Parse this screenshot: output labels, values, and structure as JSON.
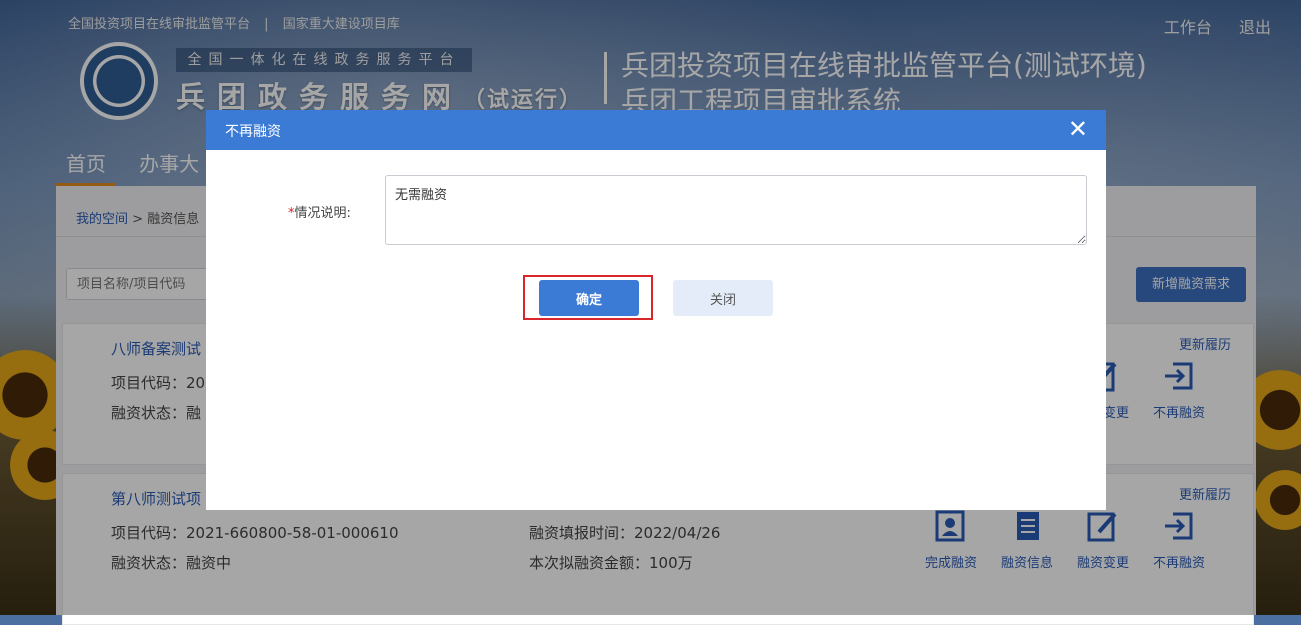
{
  "header": {
    "top_links": [
      "全国投资项目在线审批监管平台",
      "国家重大建设项目库"
    ],
    "top_separator": "|",
    "top_right": [
      "工作台",
      "退出"
    ],
    "slogan": "全国一体化在线政务服务平台",
    "site_name": "兵团政务服务网",
    "site_trial": "（试运行）",
    "system_title_1": "兵团投资项目在线审批监管平台(测试环境)",
    "system_title_2": "兵团工程项目审批系统"
  },
  "nav": {
    "items": [
      "首页",
      "办事大"
    ]
  },
  "content": {
    "breadcrumb_link": "我的空间",
    "breadcrumb_sep": " > ",
    "breadcrumb_current": "融资信息",
    "search_placeholder": "项目名称/项目代码",
    "add_button": "新增融资需求",
    "cards": [
      {
        "name": "八师备案测试",
        "code_label": "项目代码：20",
        "status_label": "融资状态：融",
        "history": "更新履历",
        "actions": [
          "融资变更",
          "不再融资"
        ]
      },
      {
        "name": "第八师测试项",
        "code_label": "项目代码：2021-660800-58-01-000610",
        "status_label": "融资状态：融资中",
        "report_time": "融资填报时间：2022/04/26",
        "amount": "本次拟融资金额：100万",
        "history": "更新履历",
        "actions": [
          "完成融资",
          "融资信息",
          "融资变更",
          "不再融资"
        ]
      }
    ]
  },
  "modal": {
    "title": "不再融资",
    "close_glyph": "✕",
    "required_mark": "*",
    "field_label": "情况说明:",
    "field_value": "无需融资",
    "confirm_label": "确定",
    "close_label": "关闭"
  },
  "colors": {
    "primary": "#3c7bd5",
    "highlight_border": "#d9262b",
    "secondary_button": "#e3ecf8",
    "required": "#e02020",
    "link": "#2a5bb5"
  }
}
